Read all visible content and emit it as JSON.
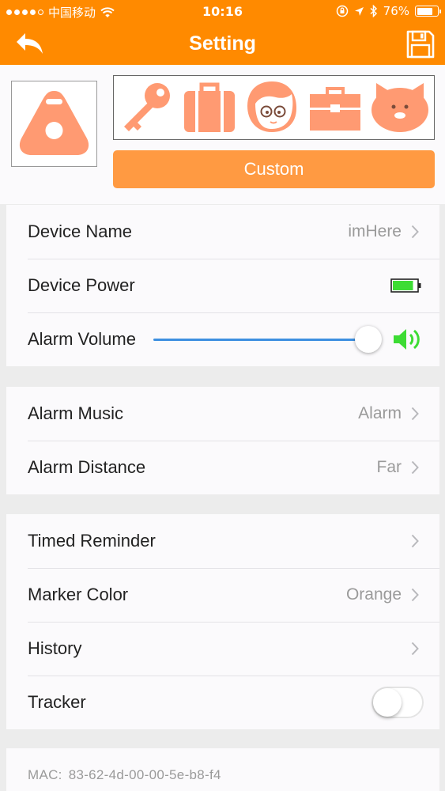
{
  "status_bar": {
    "carrier": "中国移动",
    "time": "10:16",
    "battery_percent": "76%",
    "battery_level": 0.76,
    "signal_bars": 4,
    "icons": [
      "signal-dots-icon",
      "wifi-icon",
      "rotation-lock-icon",
      "location-arrow-icon",
      "bluetooth-icon",
      "battery-icon"
    ]
  },
  "navbar": {
    "title": "Setting",
    "back_icon": "back-arrow-icon",
    "save_icon": "save-floppy-icon"
  },
  "tag": {
    "device_icon": "triangle-tag-icon",
    "icon_options": [
      "key-icon",
      "suitcase-icon",
      "child-face-icon",
      "toolbox-icon",
      "pig-icon"
    ],
    "custom_label": "Custom",
    "accent_color": "#ff9a42"
  },
  "group1": {
    "device_name_label": "Device Name",
    "device_name_value": "imHere",
    "device_power_label": "Device Power",
    "device_power_level": 0.85,
    "alarm_volume_label": "Alarm Volume",
    "alarm_volume_level": 1.0
  },
  "group2": {
    "alarm_music_label": "Alarm Music",
    "alarm_music_value": "Alarm",
    "alarm_distance_label": "Alarm Distance",
    "alarm_distance_value": "Far"
  },
  "group3": {
    "timed_reminder_label": "Timed Reminder",
    "marker_color_label": "Marker Color",
    "marker_color_value": "Orange",
    "history_label": "History",
    "tracker_label": "Tracker",
    "tracker_on": false
  },
  "footer": {
    "mac_label": "MAC:",
    "mac_value": "83-62-4d-00-00-5e-b8-f4"
  },
  "colors": {
    "brand": "#ff8a00",
    "tag_icon": "#ff9a72",
    "slider": "#3d8fe0",
    "battery_fill": "#3ddc34",
    "speaker": "#3ddc34"
  }
}
